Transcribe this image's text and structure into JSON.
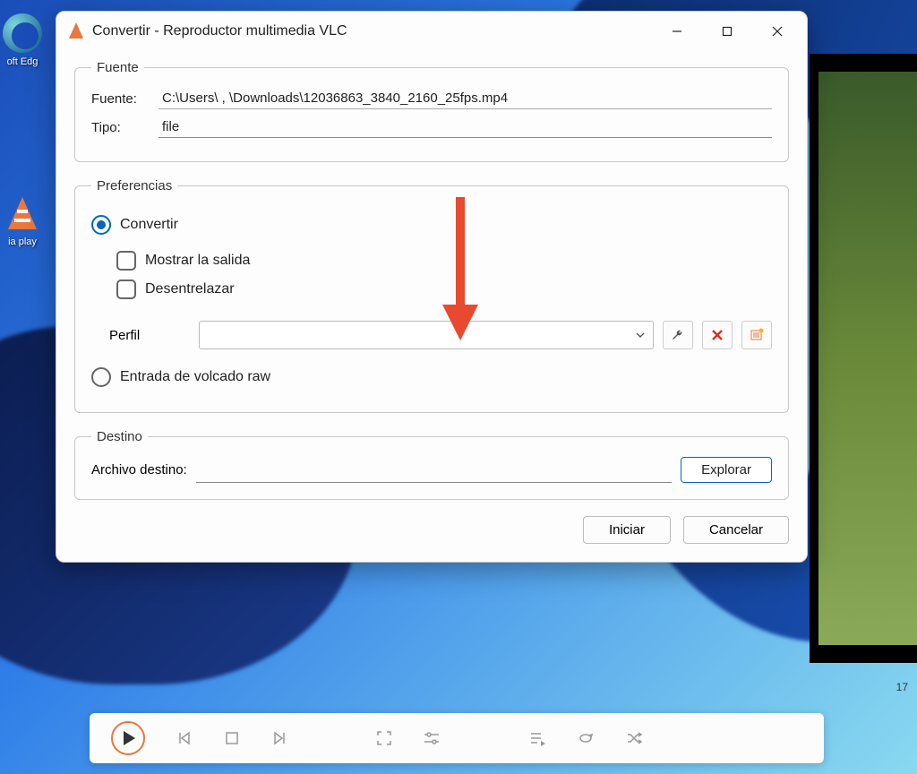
{
  "desktop": {
    "edge_label": "oft Edg",
    "vlc_label": "ia play"
  },
  "video": {
    "time_end": "17"
  },
  "dialog": {
    "title": "Convertir - Reproductor multimedia VLC",
    "fuente": {
      "legend": "Fuente",
      "source_label": "Fuente:",
      "source_value": "C:\\Users\\           ,              \\Downloads\\12036863_3840_2160_25fps.mp4",
      "type_label": "Tipo:",
      "type_value": "file"
    },
    "prefs": {
      "legend": "Preferencias",
      "convert": "Convertir",
      "show_output": "Mostrar la salida",
      "deinterlace": "Desentrelazar",
      "profile": "Perfil",
      "raw_dump": "Entrada de volcado raw"
    },
    "dest": {
      "legend": "Destino",
      "label": "Archivo destino:",
      "browse": "Explorar"
    },
    "footer": {
      "start": "Iniciar",
      "cancel": "Cancelar"
    }
  }
}
